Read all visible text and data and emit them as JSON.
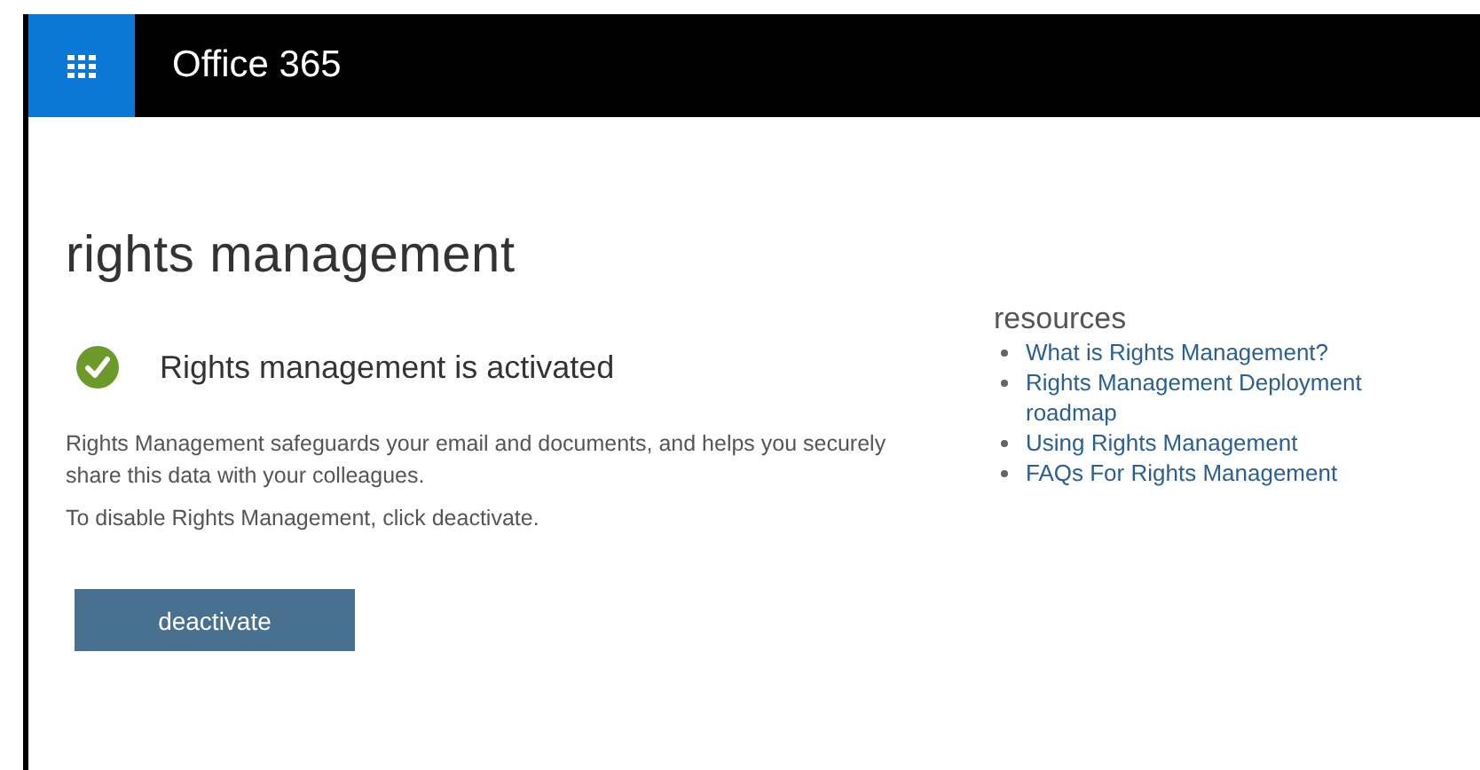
{
  "header": {
    "title": "Office 365"
  },
  "page": {
    "title": "rights management"
  },
  "status": {
    "activated": true,
    "text": "Rights management is activated"
  },
  "description": [
    "Rights Management safeguards your email and documents, and helps you securely share this data with your colleagues.",
    "To disable Rights Management, click deactivate."
  ],
  "button": {
    "label": "deactivate"
  },
  "resources": {
    "title": "resources",
    "links": [
      {
        "label": "What is Rights Management?"
      },
      {
        "label": "Rights Management Deployment roadmap"
      },
      {
        "label": "Using Rights Management"
      },
      {
        "label": "FAQs For Rights Management"
      }
    ]
  }
}
